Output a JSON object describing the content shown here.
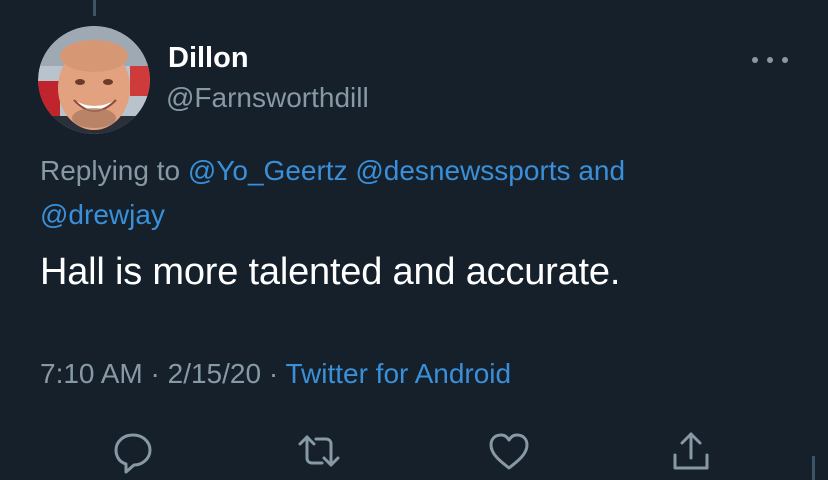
{
  "tweet": {
    "author": {
      "name": "Dillon",
      "handle": "@Farnsworthdill"
    },
    "replying_to": {
      "prefix": "Replying to",
      "mentions": [
        "@Yo_Geertz",
        "@desnewssports"
      ],
      "conjunction": "and",
      "last_mention": "@drewjay"
    },
    "text": "Hall is more talented and accurate.",
    "meta": {
      "time": "7:10 AM",
      "separator": "·",
      "date": "2/15/20",
      "source": "Twitter for Android"
    },
    "actions": [
      {
        "name": "reply",
        "icon": "reply-icon"
      },
      {
        "name": "retweet",
        "icon": "retweet-icon"
      },
      {
        "name": "like",
        "icon": "heart-icon"
      },
      {
        "name": "share",
        "icon": "share-icon"
      }
    ]
  },
  "colors": {
    "background": "#15202b",
    "primary_text": "#ffffff",
    "secondary_text": "#8899a6",
    "link": "#3a8fd9"
  }
}
